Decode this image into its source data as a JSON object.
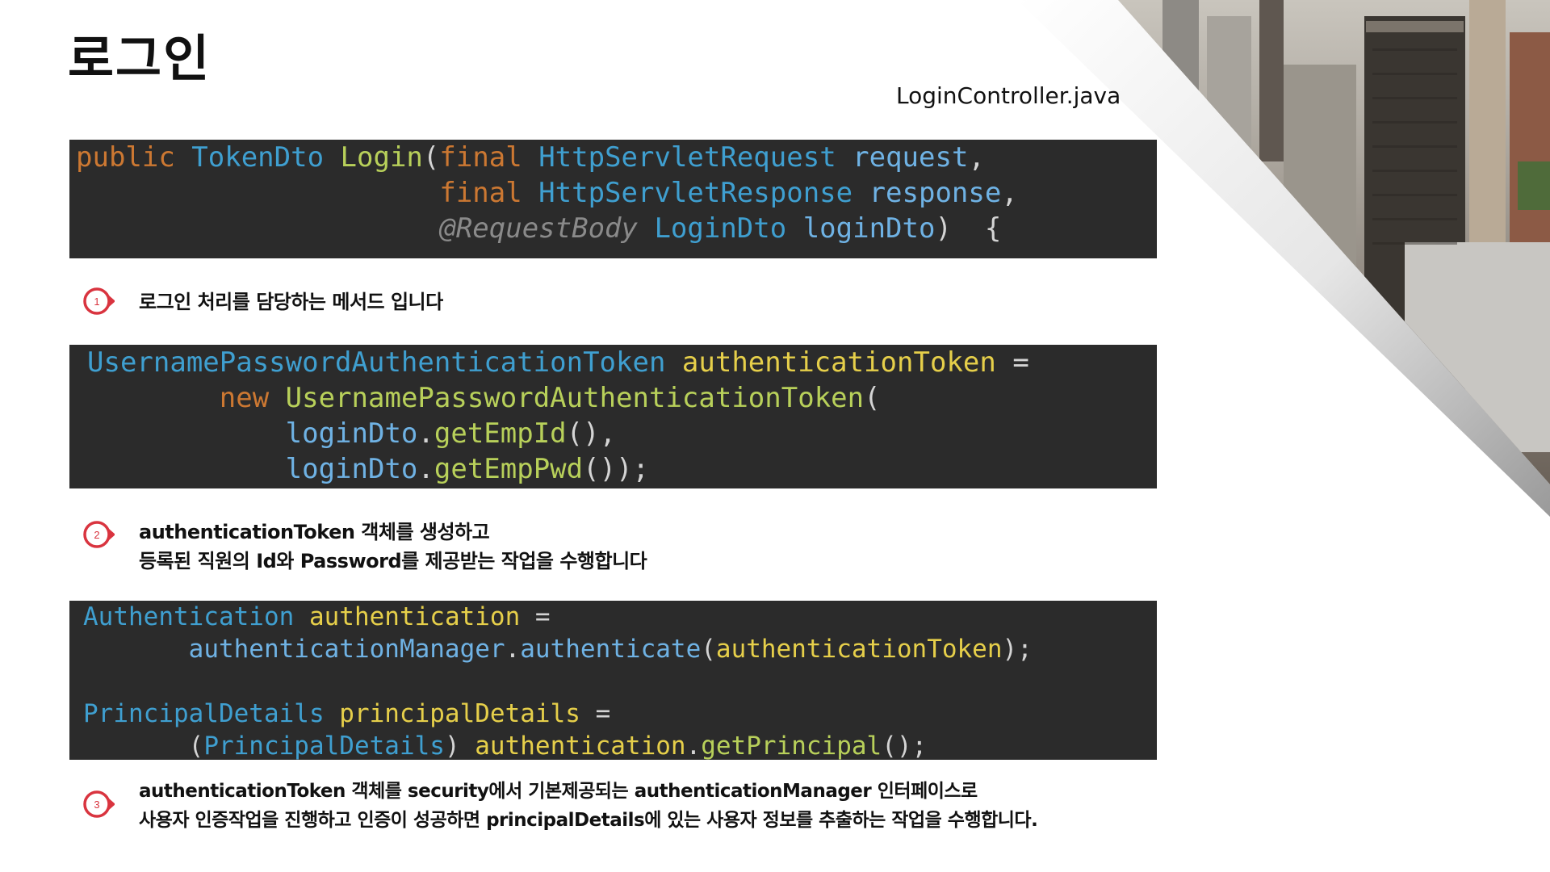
{
  "title": "로그인",
  "filename": "LoginController.java",
  "code_blocks": [
    {
      "lines": [
        [
          [
            "kw",
            "public "
          ],
          [
            "typ",
            "TokenDto "
          ],
          [
            "fn",
            "Login"
          ],
          [
            "pl",
            "("
          ],
          [
            "kw",
            "final "
          ],
          [
            "typ",
            "HttpServletRequest "
          ],
          [
            "par",
            "request"
          ],
          [
            "pl",
            ","
          ]
        ],
        [
          [
            "pl",
            "                      "
          ],
          [
            "kw",
            "final "
          ],
          [
            "typ",
            "HttpServletResponse "
          ],
          [
            "par",
            "response"
          ],
          [
            "pl",
            ","
          ]
        ],
        [
          [
            "pl",
            "                      "
          ],
          [
            "ann",
            "@RequestBody "
          ],
          [
            "typ",
            "LoginDto "
          ],
          [
            "par",
            "loginDto"
          ],
          [
            "pl",
            ")  {"
          ]
        ]
      ]
    },
    {
      "lines": [
        [
          [
            "typ",
            "UsernamePasswordAuthenticationToken "
          ],
          [
            "var",
            "authenticationToken"
          ],
          [
            "pl",
            " ="
          ]
        ],
        [
          [
            "pl",
            "        "
          ],
          [
            "kw",
            "new "
          ],
          [
            "fn",
            "UsernamePasswordAuthenticationToken"
          ],
          [
            "pl",
            "("
          ]
        ],
        [
          [
            "pl",
            "            "
          ],
          [
            "par",
            "loginDto"
          ],
          [
            "pl",
            "."
          ],
          [
            "fn",
            "getEmpId"
          ],
          [
            "pl",
            "(),"
          ]
        ],
        [
          [
            "pl",
            "            "
          ],
          [
            "par",
            "loginDto"
          ],
          [
            "pl",
            "."
          ],
          [
            "fn",
            "getEmpPwd"
          ],
          [
            "pl",
            "());"
          ]
        ]
      ]
    },
    {
      "lines": [
        [
          [
            "typ",
            "Authentication "
          ],
          [
            "var",
            "authentication"
          ],
          [
            "pl",
            " ="
          ]
        ],
        [
          [
            "pl",
            "       "
          ],
          [
            "par",
            "authenticationManager"
          ],
          [
            "pl",
            "."
          ],
          [
            "par",
            "authenticate"
          ],
          [
            "pl",
            "("
          ],
          [
            "var",
            "authenticationToken"
          ],
          [
            "pl",
            ");"
          ]
        ],
        [
          [
            "pl",
            " "
          ]
        ],
        [
          [
            "typ",
            "PrincipalDetails "
          ],
          [
            "var",
            "principalDetails"
          ],
          [
            "pl",
            " ="
          ]
        ],
        [
          [
            "pl",
            "       ("
          ],
          [
            "typ",
            "PrincipalDetails"
          ],
          [
            "pl",
            ") "
          ],
          [
            "var",
            "authentication"
          ],
          [
            "pl",
            "."
          ],
          [
            "fn",
            "getPrincipal"
          ],
          [
            "pl",
            "();"
          ]
        ]
      ]
    }
  ],
  "notes": [
    {
      "number": "1",
      "lines": [
        "로그인 처리를 담당하는 메서드 입니다"
      ]
    },
    {
      "number": "2",
      "lines": [
        "authenticationToken 객체를 생성하고",
        "등록된 직원의 Id와 Password를 제공받는 작업을 수행합니다"
      ]
    },
    {
      "number": "3",
      "lines": [
        " authenticationToken 객체를 security에서 기본제공되는 authenticationManager 인터페이스로",
        "사용자 인증작업을 진행하고 인증이 성공하면 principalDetails에 있는 사용자 정보를 추출하는 작업을 수행합니다."
      ]
    }
  ],
  "colors": {
    "code_bg": "#2b2b2b",
    "keyword": "#cc7832",
    "type": "#3f9fd0",
    "method": "#b8d05a",
    "variable": "#e6cf4a",
    "marker": "#d9343f"
  }
}
